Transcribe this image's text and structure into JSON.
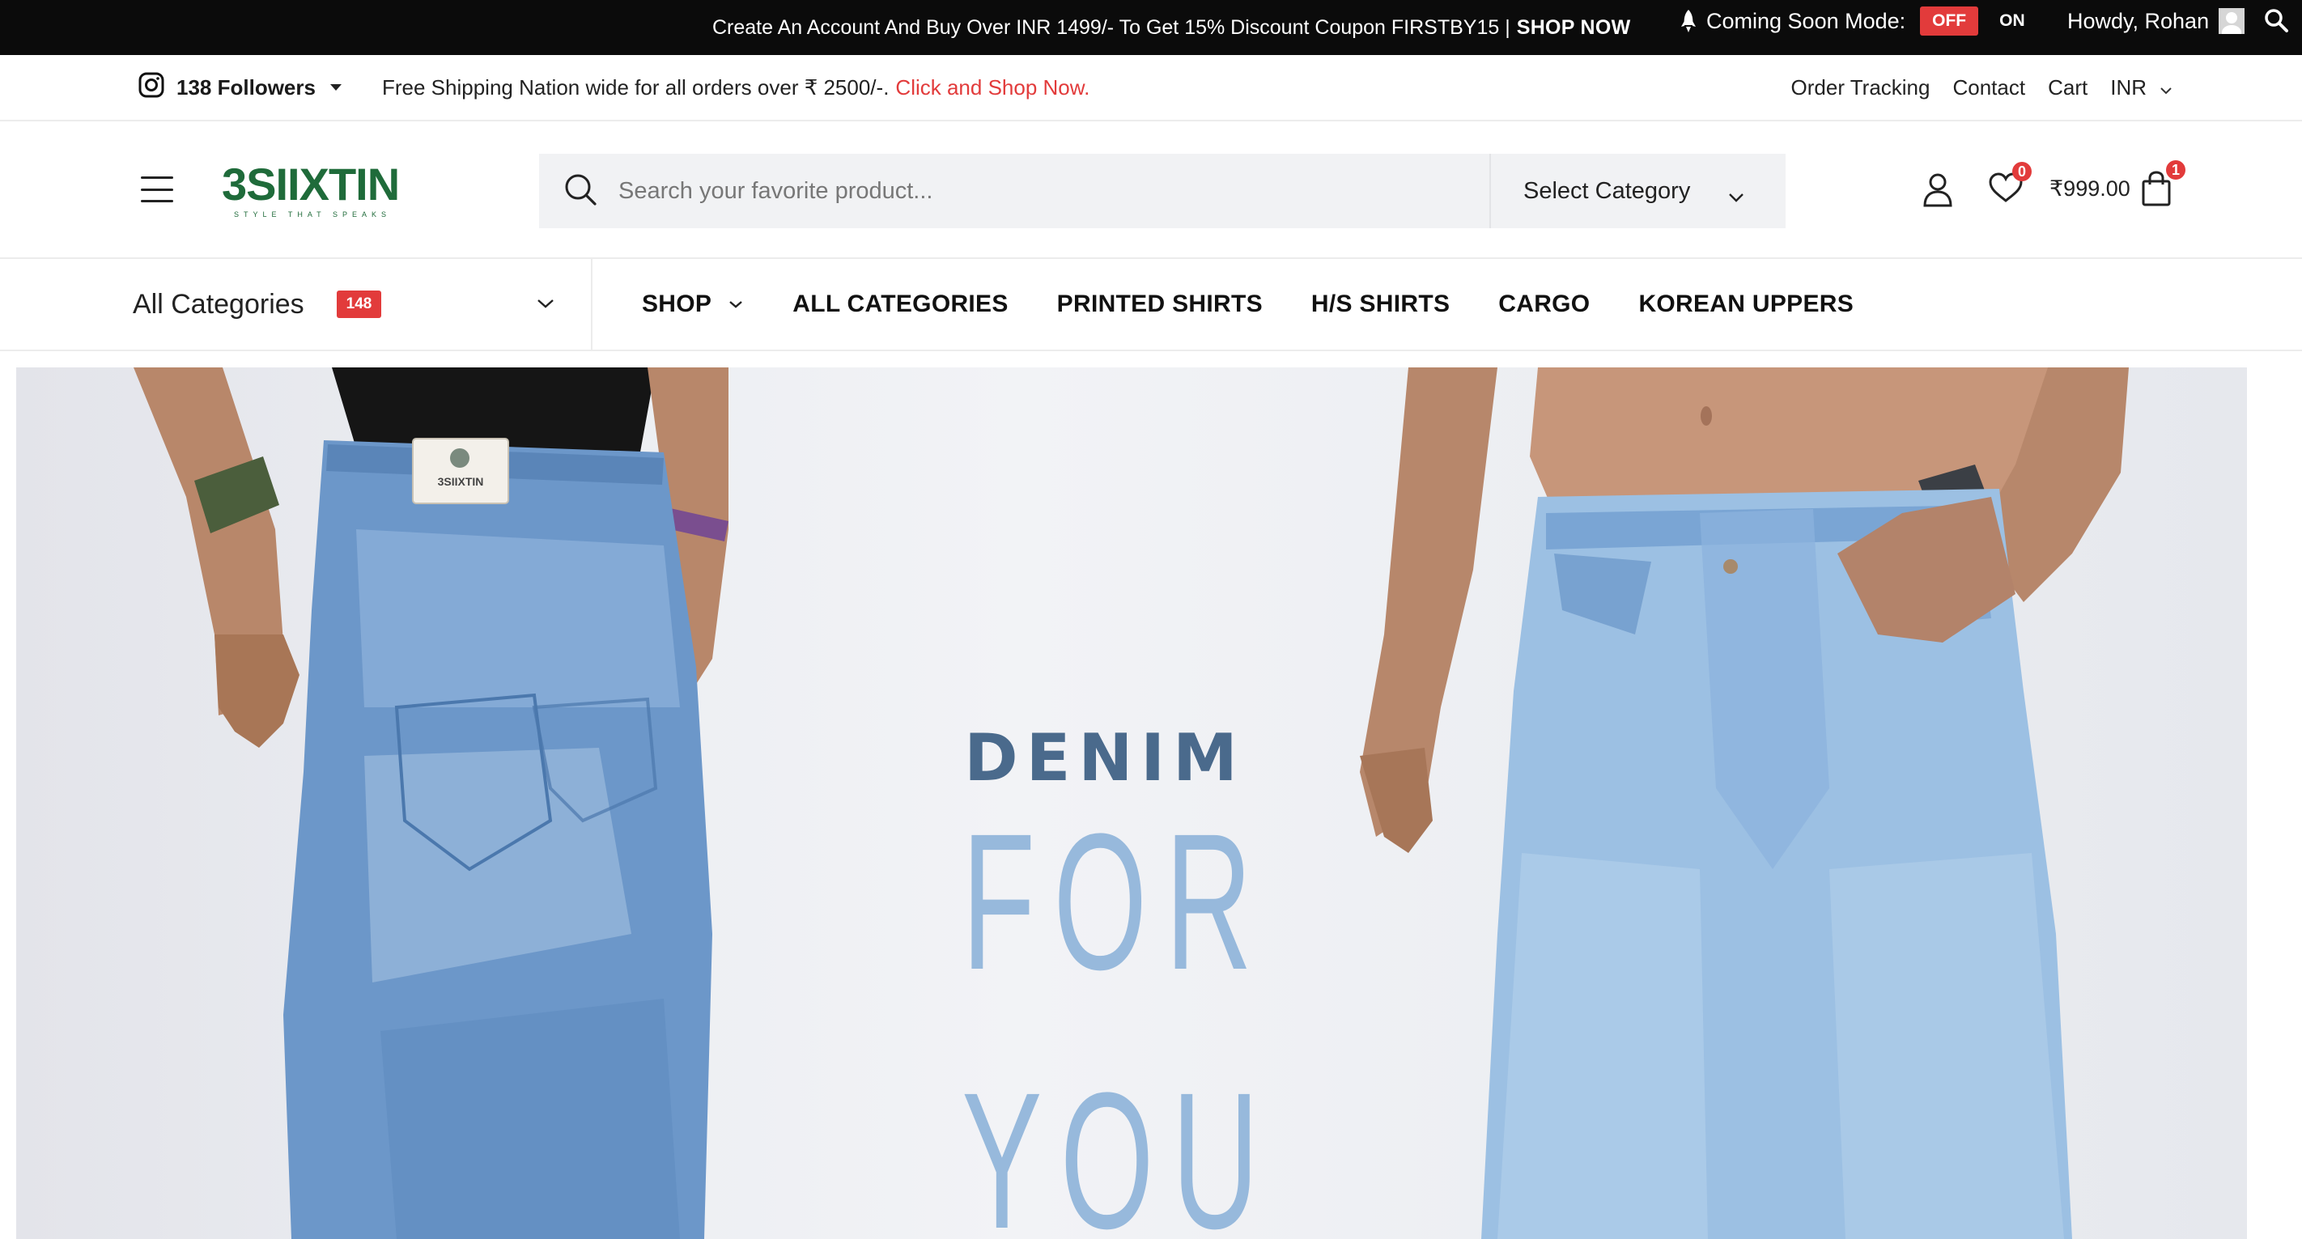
{
  "topbar": {
    "promo_text": "Create An Account And Buy Over INR 1499/- To Get 15% Discount Coupon FIRSTBY15 |",
    "promo_link": "SHOP NOW",
    "coming_soon_label": "Coming Soon Mode:",
    "toggle_off": "OFF",
    "toggle_on": "ON",
    "howdy": "Howdy, Rohan"
  },
  "infobar": {
    "followers": "138 Followers",
    "shipping_text": "Free Shipping Nation wide for all orders over ₹ 2500/-.",
    "shipping_link": "Click and Shop Now.",
    "links": [
      "Order Tracking",
      "Contact",
      "Cart"
    ],
    "currency": "INR"
  },
  "header": {
    "logo_main": "3SIIXTIN",
    "logo_tagline": "STYLE THAT SPEAKS",
    "search_placeholder": "Search your favorite product...",
    "category_select": "Select Category",
    "wishlist_count": "0",
    "cart_total": "₹999.00",
    "cart_count": "1"
  },
  "nav": {
    "all_categories": "All Categories",
    "category_count": "148",
    "menu": [
      "SHOP",
      "ALL CATEGORIES",
      "PRINTED SHIRTS",
      "H/S SHIRTS",
      "CARGO",
      "KOREAN UPPERS"
    ]
  },
  "hero": {
    "line1": "DENIM",
    "line2": "FOR YOU",
    "label_patch": "3SIIXTIN"
  },
  "colors": {
    "accent_red": "#e23b3b",
    "brand_green": "#1f6b3a",
    "topbar_bg": "#0b0b0b",
    "search_bg": "#f1f2f4"
  }
}
